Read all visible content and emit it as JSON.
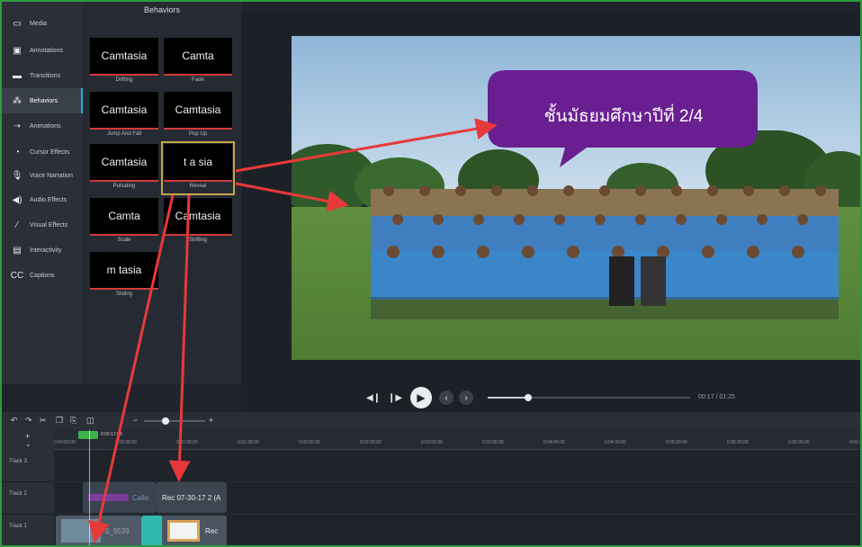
{
  "tools": [
    {
      "label": "Media",
      "icon": "media-icon"
    },
    {
      "label": "Annotations",
      "icon": "annotations-icon"
    },
    {
      "label": "Transitions",
      "icon": "transitions-icon"
    },
    {
      "label": "Behaviors",
      "icon": "behaviors-icon",
      "active": true
    },
    {
      "label": "Animations",
      "icon": "animations-icon"
    },
    {
      "label": "Cursor Effects",
      "icon": "cursor-icon"
    },
    {
      "label": "Voice Narration",
      "icon": "microphone-icon"
    },
    {
      "label": "Audio Effects",
      "icon": "speaker-icon"
    },
    {
      "label": "Visual Effects",
      "icon": "wand-icon"
    },
    {
      "label": "Interactivity",
      "icon": "interactivity-icon"
    },
    {
      "label": "Captions",
      "icon": "cc-icon"
    }
  ],
  "behaviors": {
    "title": "Behaviors",
    "tiles": [
      {
        "preview": "Camtasia",
        "label": "Drifting"
      },
      {
        "preview": "Camta",
        "label": "Fade"
      },
      {
        "preview": "Camtasia",
        "label": "Jump And Fall"
      },
      {
        "preview": "Camtasia",
        "label": "Pop Up"
      },
      {
        "preview": "Camtasia",
        "label": "Pulsating"
      },
      {
        "preview": "t a sia",
        "label": "Reveal",
        "selected": true
      },
      {
        "preview": "Camta",
        "label": "Scale"
      },
      {
        "preview": "Camtasia",
        "label": "Shifting"
      },
      {
        "preview": "m tasia",
        "label": "Sliding"
      }
    ]
  },
  "canvas": {
    "callout_text": "ชั้นมัธยมศึกษาปีที่ 2/4",
    "callout_color": "#6a1f91"
  },
  "player": {
    "timecode": "00:17 / 01:25",
    "progress": 0.2
  },
  "timeline": {
    "zoom_minus": "−",
    "zoom_plus": "+",
    "playhead_time": "0:00:17;08",
    "ruler_ticks": [
      "0:00:00;00",
      "0:00:30;00",
      "0:01:00;00",
      "0:01:30;00",
      "0:02:00;00",
      "0:02:30;00",
      "0:03:00;00",
      "0:03:30;00",
      "0:04:00;00",
      "0:04:30;00",
      "0:05:00;00",
      "0:05:30;00",
      "0:06:00;00",
      "0:06:30"
    ],
    "tracks": [
      {
        "name": "Track 3"
      },
      {
        "name": "Track 2"
      },
      {
        "name": "Track 1"
      }
    ],
    "clips": {
      "track2_callout": "Callo",
      "track2_rec": "Rec 07-30-17 2 (A",
      "track1_rec": "Rec",
      "track1_label": "S_9539"
    }
  },
  "colors": {
    "accent": "#1fb0e6",
    "arrow": "#e8393a",
    "frame": "#2e9a3e",
    "callout": "#6a1f91"
  }
}
